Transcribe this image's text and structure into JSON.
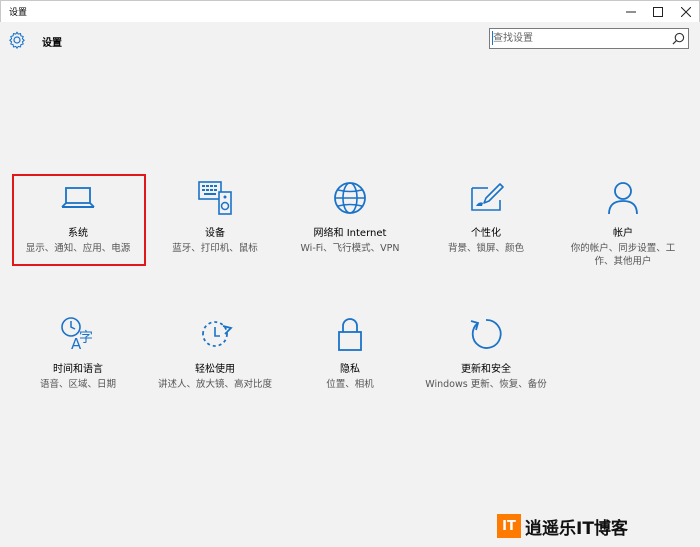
{
  "window": {
    "title": "设置"
  },
  "header": {
    "title": "设置"
  },
  "search": {
    "placeholder": "查找设置"
  },
  "tiles": [
    {
      "name": "系统",
      "desc": "显示、通知、应用、电源",
      "icon": "laptop-icon"
    },
    {
      "name": "设备",
      "desc": "蓝牙、打印机、鼠标",
      "icon": "devices-icon"
    },
    {
      "name": "网络和 Internet",
      "desc": "Wi-Fi、飞行模式、VPN",
      "icon": "globe-icon"
    },
    {
      "name": "个性化",
      "desc": "背景、锁屏、颜色",
      "icon": "personalization-icon"
    },
    {
      "name": "帐户",
      "desc": "你的帐户、同步设置、工作、其他用户",
      "icon": "person-icon"
    },
    {
      "name": "时间和语言",
      "desc": "语音、区域、日期",
      "icon": "time-language-icon"
    },
    {
      "name": "轻松使用",
      "desc": "讲述人、放大镜、高对比度",
      "icon": "ease-of-access-icon"
    },
    {
      "name": "隐私",
      "desc": "位置、相机",
      "icon": "lock-icon"
    },
    {
      "name": "更新和安全",
      "desc": "Windows 更新、恢复、备份",
      "icon": "update-icon"
    }
  ],
  "watermark": {
    "logo": "IT",
    "text": "逍遥乐IT博客"
  },
  "colors": {
    "accent": "#1a73c8",
    "selection": "#e01818",
    "watermark": "#ff7a00"
  }
}
